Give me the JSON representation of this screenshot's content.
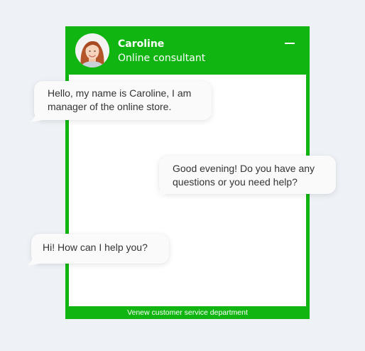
{
  "agent": {
    "name": "Caroline",
    "role": "Online consultant",
    "avatar_icon": "woman-portrait-avatar"
  },
  "header": {
    "minimize_icon": "minimize-icon"
  },
  "messages": [
    {
      "text": "Hello, my name is Caroline, I am\nmanager of the online store."
    },
    {
      "text": "Good evening! Do you have any\nquestions or you need help?"
    },
    {
      "text": "Hi! How can I help you?"
    }
  ],
  "footer": {
    "text": "Venew customer service department"
  },
  "colors": {
    "brand_green": "#11b511",
    "page_background": "#eef2f7",
    "bubble_background": "#fafafa",
    "text": "#333333"
  }
}
